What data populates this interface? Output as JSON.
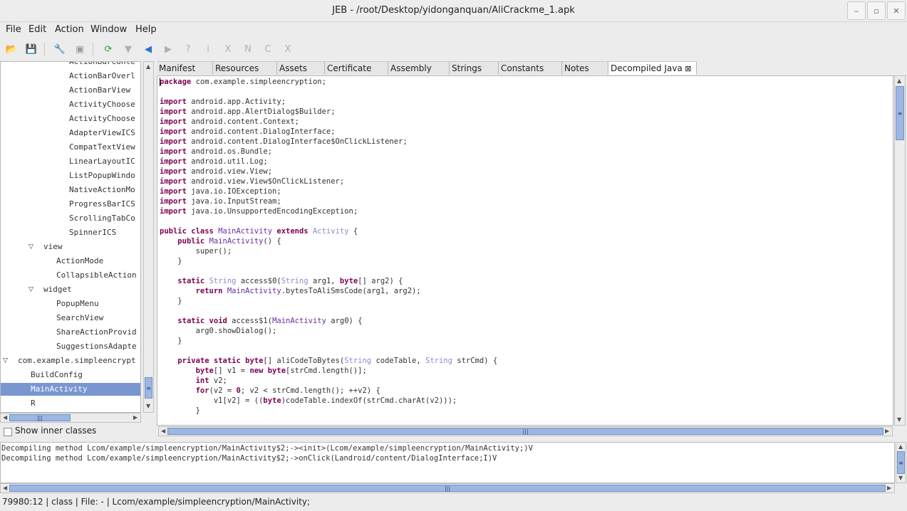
{
  "window": {
    "title": "JEB - /root/Desktop/yidonganquan/AliCrackme_1.apk"
  },
  "window_buttons": [
    {
      "name": "minimize-button",
      "glyph": "‒"
    },
    {
      "name": "maximize-button",
      "glyph": "▫"
    },
    {
      "name": "close-button",
      "glyph": "✕"
    }
  ],
  "menu": [
    "File",
    "Edit",
    "Action",
    "Window",
    "Help"
  ],
  "toolbar": [
    {
      "name": "open-folder-icon",
      "glyph": "📂",
      "color": "#d9a21a"
    },
    {
      "name": "save-icon",
      "glyph": "💾",
      "color": "#3b6fb0"
    },
    {
      "name": "wrench-icon",
      "glyph": "🔧",
      "color": "#c27a2a"
    },
    {
      "name": "options-icon",
      "glyph": "▣",
      "color": "#9a9a9a"
    },
    {
      "name": "refresh-icon",
      "glyph": "⟳",
      "color": "#2a9a3a"
    },
    {
      "name": "filter-icon",
      "glyph": "▼",
      "color": "#b0b0b0"
    },
    {
      "name": "navigate-back-icon",
      "glyph": "◀",
      "color": "#2a6fd0"
    },
    {
      "name": "navigate-forward-icon",
      "glyph": "▶",
      "color": "#b0b0b0"
    },
    {
      "name": "help-icon",
      "glyph": "?",
      "color": "#b0b0b0"
    },
    {
      "name": "info-icon",
      "glyph": "i",
      "color": "#b0b0b0"
    },
    {
      "name": "x-reference-icon",
      "glyph": "X",
      "color": "#b0b0b0"
    },
    {
      "name": "n-rename-icon",
      "glyph": "N",
      "color": "#b0b0b0"
    },
    {
      "name": "c-comment-icon",
      "glyph": "C",
      "color": "#b0b0b0"
    },
    {
      "name": "close-x-icon",
      "glyph": "X",
      "color": "#b0b0b0"
    }
  ],
  "tree": {
    "items": [
      {
        "label": "ActionBarConte",
        "indent": 97,
        "expand": ""
      },
      {
        "label": "ActionBarOverl",
        "indent": 97,
        "expand": ""
      },
      {
        "label": "ActionBarView",
        "indent": 97,
        "expand": ""
      },
      {
        "label": "ActivityChoose",
        "indent": 97,
        "expand": ""
      },
      {
        "label": "ActivityChoose",
        "indent": 97,
        "expand": ""
      },
      {
        "label": "AdapterViewICS",
        "indent": 97,
        "expand": ""
      },
      {
        "label": "CompatTextView",
        "indent": 97,
        "expand": ""
      },
      {
        "label": "LinearLayoutIC",
        "indent": 97,
        "expand": ""
      },
      {
        "label": "ListPopupWindo",
        "indent": 97,
        "expand": ""
      },
      {
        "label": "NativeActionMo",
        "indent": 97,
        "expand": ""
      },
      {
        "label": "ProgressBarICS",
        "indent": 97,
        "expand": ""
      },
      {
        "label": "ScrollingTabCo",
        "indent": 97,
        "expand": ""
      },
      {
        "label": "SpinnerICS",
        "indent": 97,
        "expand": ""
      },
      {
        "label": "view",
        "indent": 61,
        "expand": "▽"
      },
      {
        "label": "ActionMode",
        "indent": 79,
        "expand": ""
      },
      {
        "label": "CollapsibleAction",
        "indent": 79,
        "expand": ""
      },
      {
        "label": "widget",
        "indent": 61,
        "expand": "▽"
      },
      {
        "label": "PopupMenu",
        "indent": 79,
        "expand": ""
      },
      {
        "label": "SearchView",
        "indent": 79,
        "expand": ""
      },
      {
        "label": "ShareActionProvid",
        "indent": 79,
        "expand": ""
      },
      {
        "label": "SuggestionsAdapte",
        "indent": 79,
        "expand": ""
      },
      {
        "label": "com.example.simpleencrypt",
        "indent": 25,
        "expand": "▽"
      },
      {
        "label": "BuildConfig",
        "indent": 43,
        "expand": ""
      },
      {
        "label": "MainActivity",
        "indent": 43,
        "expand": "",
        "selected": true
      },
      {
        "label": "R",
        "indent": 43,
        "expand": ""
      }
    ],
    "show_inner_classes": "Show inner classes"
  },
  "tabs": [
    "Manifest",
    "Resources",
    "Assets",
    "Certificate",
    "Assembly",
    "Strings",
    "Constants",
    "Notes",
    "Decompiled Java"
  ],
  "active_tab": "Decompiled Java",
  "code": [
    [
      [
        "kw",
        "package"
      ],
      [
        "p",
        " com.example.simpleencryption;"
      ]
    ],
    [],
    [
      [
        "kw",
        "import"
      ],
      [
        "p",
        " android.app.Activity;"
      ]
    ],
    [
      [
        "kw",
        "import"
      ],
      [
        "p",
        " android.app.AlertDialog$Builder;"
      ]
    ],
    [
      [
        "kw",
        "import"
      ],
      [
        "p",
        " android.content.Context;"
      ]
    ],
    [
      [
        "kw",
        "import"
      ],
      [
        "p",
        " android.content.DialogInterface;"
      ]
    ],
    [
      [
        "kw",
        "import"
      ],
      [
        "p",
        " android.content.DialogInterface$OnClickListener;"
      ]
    ],
    [
      [
        "kw",
        "import"
      ],
      [
        "p",
        " android.os.Bundle;"
      ]
    ],
    [
      [
        "kw",
        "import"
      ],
      [
        "p",
        " android.util.Log;"
      ]
    ],
    [
      [
        "kw",
        "import"
      ],
      [
        "p",
        " android.view.View;"
      ]
    ],
    [
      [
        "kw",
        "import"
      ],
      [
        "p",
        " android.view.View$OnClickListener;"
      ]
    ],
    [
      [
        "kw",
        "import"
      ],
      [
        "p",
        " java.io.IOException;"
      ]
    ],
    [
      [
        "kw",
        "import"
      ],
      [
        "p",
        " java.io.InputStream;"
      ]
    ],
    [
      [
        "kw",
        "import"
      ],
      [
        "p",
        " java.io.UnsupportedEncodingException;"
      ]
    ],
    [],
    [
      [
        "kw",
        "public class"
      ],
      [
        "p",
        " "
      ],
      [
        "tbl",
        "MainActivity"
      ],
      [
        "p",
        " "
      ],
      [
        "kw",
        "extends"
      ],
      [
        "p",
        " "
      ],
      [
        "ty",
        "Activity"
      ],
      [
        "p",
        " {"
      ]
    ],
    [
      [
        "p",
        "    "
      ],
      [
        "kw",
        "public"
      ],
      [
        "p",
        " "
      ],
      [
        "tbl",
        "MainActivity"
      ],
      [
        "p",
        "() {"
      ]
    ],
    [
      [
        "p",
        "        super();"
      ]
    ],
    [
      [
        "p",
        "    }"
      ]
    ],
    [],
    [
      [
        "p",
        "    "
      ],
      [
        "kw",
        "static"
      ],
      [
        "p",
        " "
      ],
      [
        "ty",
        "String"
      ],
      [
        "p",
        " access$0("
      ],
      [
        "ty",
        "String"
      ],
      [
        "p",
        " arg1, "
      ],
      [
        "kw",
        "byte"
      ],
      [
        "p",
        "[] arg2) {"
      ]
    ],
    [
      [
        "p",
        "        "
      ],
      [
        "kw",
        "return"
      ],
      [
        "p",
        " "
      ],
      [
        "tbl",
        "MainActivity"
      ],
      [
        "p",
        ".bytesToAliSmsCode(arg1, arg2);"
      ]
    ],
    [
      [
        "p",
        "    }"
      ]
    ],
    [],
    [
      [
        "p",
        "    "
      ],
      [
        "kw",
        "static void"
      ],
      [
        "p",
        " access$1("
      ],
      [
        "tbl",
        "MainActivity"
      ],
      [
        "p",
        " arg0) {"
      ]
    ],
    [
      [
        "p",
        "        arg0.showDialog();"
      ]
    ],
    [
      [
        "p",
        "    }"
      ]
    ],
    [],
    [
      [
        "p",
        "    "
      ],
      [
        "kw",
        "private static byte"
      ],
      [
        "p",
        "[] aliCodeToBytes("
      ],
      [
        "ty",
        "String"
      ],
      [
        "p",
        " codeTable, "
      ],
      [
        "ty",
        "String"
      ],
      [
        "p",
        " strCmd) {"
      ]
    ],
    [
      [
        "p",
        "        "
      ],
      [
        "kw",
        "byte"
      ],
      [
        "p",
        "[] v1 = "
      ],
      [
        "kw",
        "new byte"
      ],
      [
        "p",
        "[strCmd.length()];"
      ]
    ],
    [
      [
        "p",
        "        "
      ],
      [
        "kw",
        "int"
      ],
      [
        "p",
        " v2;"
      ]
    ],
    [
      [
        "p",
        "        "
      ],
      [
        "kw",
        "for"
      ],
      [
        "p",
        "(v2 = "
      ],
      [
        "kw",
        "0"
      ],
      [
        "p",
        "; v2 < strCmd.length(); ++v2) {"
      ]
    ],
    [
      [
        "p",
        "            v1[v2] = (("
      ],
      [
        "kw",
        "byte"
      ],
      [
        "p",
        ")codeTable.indexOf(strCmd.charAt(v2)));"
      ]
    ],
    [
      [
        "p",
        "        }"
      ]
    ]
  ],
  "console": [
    "Decompiling method Lcom/example/simpleencryption/MainActivity$2;-><init>(Lcom/example/simpleencryption/MainActivity;)V",
    "Decompiling method Lcom/example/simpleencryption/MainActivity$2;->onClick(Landroid/content/DialogInterface;I)V"
  ],
  "status": "79980:12  |  class  |  File: -  |  Lcom/example/simpleencryption/MainActivity;"
}
